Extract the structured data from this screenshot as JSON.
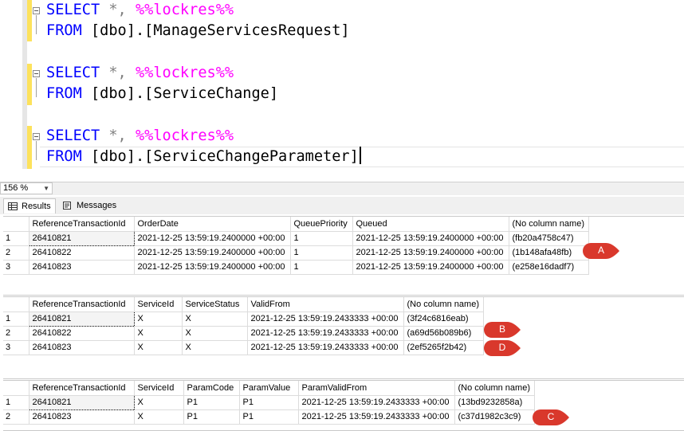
{
  "editor": {
    "lines": [
      {
        "kw": "SELECT",
        "mid": " *, ",
        "fn": "%%lockres%%"
      },
      {
        "kw": "FROM",
        "tbl": " [dbo].[ManageServicesRequest]"
      },
      {
        "kw": "SELECT",
        "mid": " *, ",
        "fn": "%%lockres%%"
      },
      {
        "kw": "FROM",
        "tbl": " [dbo].[ServiceChange]"
      },
      {
        "kw": "SELECT",
        "mid": " *, ",
        "fn": "%%lockres%%"
      },
      {
        "kw": "FROM",
        "tbl": " [dbo].[ServiceChangeParameter]"
      }
    ]
  },
  "zoom": {
    "level": "156 %"
  },
  "tabs": {
    "results": "Results",
    "messages": "Messages"
  },
  "grids": [
    {
      "columns": [
        "",
        "ReferenceTransactionId",
        "OrderDate",
        "QueuePriority",
        "Queued",
        "(No column name)"
      ],
      "rows": [
        [
          "1",
          "26410821",
          "2021-12-25 13:59:19.2400000 +00:00",
          "1",
          "2021-12-25 13:59:19.2400000 +00:00",
          "(fb20a4758c47)"
        ],
        [
          "2",
          "26410822",
          "2021-12-25 13:59:19.2400000 +00:00",
          "1",
          "2021-12-25 13:59:19.2400000 +00:00",
          "(1b148afa48fb)"
        ],
        [
          "3",
          "26410823",
          "2021-12-25 13:59:19.2400000 +00:00",
          "1",
          "2021-12-25 13:59:19.2400000 +00:00",
          "(e258e16dadf7)"
        ]
      ]
    },
    {
      "columns": [
        "",
        "ReferenceTransactionId",
        "ServiceId",
        "ServiceStatus",
        "ValidFrom",
        "(No column name)"
      ],
      "rows": [
        [
          "1",
          "26410821",
          "X",
          "X",
          "2021-12-25 13:59:19.2433333 +00:00",
          "(3f24c6816eab)"
        ],
        [
          "2",
          "26410822",
          "X",
          "X",
          "2021-12-25 13:59:19.2433333 +00:00",
          "(a69d56b089b6)"
        ],
        [
          "3",
          "26410823",
          "X",
          "X",
          "2021-12-25 13:59:19.2433333 +00:00",
          "(2ef5265f2b42)"
        ]
      ]
    },
    {
      "columns": [
        "",
        "ReferenceTransactionId",
        "ServiceId",
        "ParamCode",
        "ParamValue",
        "ParamValidFrom",
        "(No column name)"
      ],
      "rows": [
        [
          "1",
          "26410821",
          "X",
          "P1",
          "P1",
          "2021-12-25 13:59:19.2433333 +00:00",
          "(13bd9232858a)"
        ],
        [
          "2",
          "26410823",
          "X",
          "P1",
          "P1",
          "2021-12-25 13:59:19.2433333 +00:00",
          "(c37d1982c3c9)"
        ]
      ]
    }
  ],
  "callouts": [
    "A",
    "B",
    "D",
    "C"
  ],
  "colors": {
    "callout": "#d9382c",
    "keyword": "#0000ff",
    "function": "#ff00ff"
  }
}
